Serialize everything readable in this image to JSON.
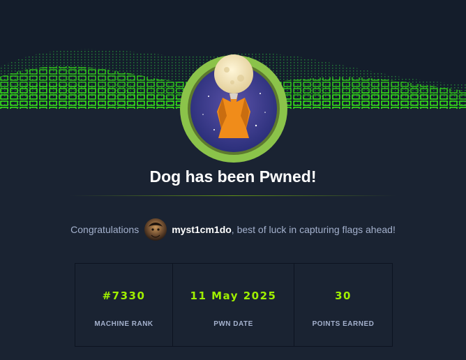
{
  "header": {
    "banner": "green cube grid",
    "badge_icon": "dog-moon-icon"
  },
  "title": "Dog has been Pwned!",
  "congrats": {
    "prefix": "Congratulations",
    "username": "myst1cm1do",
    "suffix": ", best of luck in capturing flags ahead!"
  },
  "stats": [
    {
      "value": "#7330",
      "label": "MACHINE RANK"
    },
    {
      "value": "11 May 2025",
      "label": "PWN DATE"
    },
    {
      "value": "30",
      "label": "POINTS EARNED"
    }
  ],
  "colors": {
    "accent": "#9fef00",
    "background": "#1a2332",
    "muted_text": "#a4b1cd",
    "badge_ring": "#8bc34a"
  }
}
